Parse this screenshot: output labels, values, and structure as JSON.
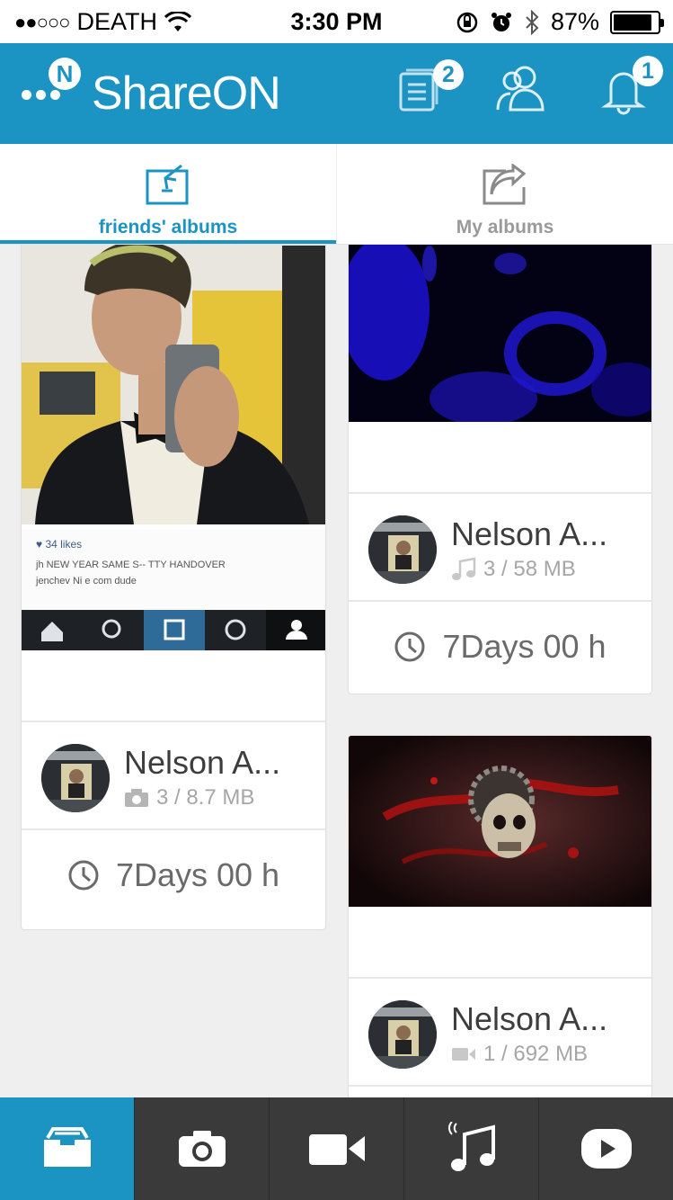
{
  "status_bar": {
    "signal": "●●○○○",
    "carrier": "DEATH",
    "time": "3:30 PM",
    "battery": "87%",
    "battery_level": 0.87
  },
  "header": {
    "logo_letter": "N",
    "title": "ShareON",
    "messages_badge": "2",
    "notifications_badge": "1",
    "icons": [
      "messages-icon",
      "friends-icon",
      "bell-icon"
    ]
  },
  "tabs": [
    {
      "label": "friends' albums",
      "icon": "album-in-icon",
      "active": true
    },
    {
      "label": "My albums",
      "icon": "album-share-icon",
      "active": false
    }
  ],
  "album_cards": [
    {
      "owner": "Nelson A...",
      "media_icon": "camera-icon",
      "meta": "3 / 8.7 MB",
      "expiry": "7Days 00 h"
    },
    {
      "owner": "Nelson A...",
      "media_icon": "music-note-icon",
      "meta": "3 / 58 MB",
      "expiry": "7Days 00 h"
    },
    {
      "owner": "Nelson A...",
      "media_icon": "video-icon",
      "meta": "1 / 692 MB",
      "expiry": ""
    }
  ],
  "bottom_nav": [
    {
      "icon": "inbox-icon",
      "active": true
    },
    {
      "icon": "camera-icon",
      "active": false
    },
    {
      "icon": "video-icon",
      "active": false
    },
    {
      "icon": "music-icon",
      "active": false
    },
    {
      "icon": "play-icon",
      "active": false
    }
  ],
  "colors": {
    "brand": "#1b93c3",
    "nav_bg": "#3a3a3a",
    "page_bg": "#efefef"
  }
}
